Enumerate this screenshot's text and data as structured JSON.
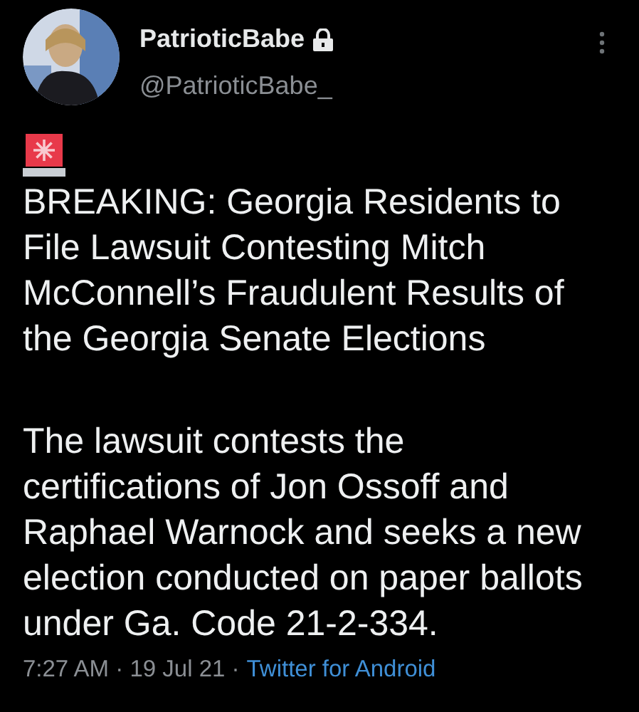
{
  "author": {
    "name": "PatrioticBabe",
    "protected": true,
    "handle": "@PatrioticBabe_"
  },
  "tweet": {
    "headline": "BREAKING: Georgia Residents to File Lawsuit Contesting Mitch McConnell’s Fraudulent Results of the Georgia Senate Elections",
    "body": "The lawsuit contests the certifications of Jon Ossoff and Raphael Warnock and seeks a new election conducted on paper ballots under Ga. Code 21-2-334."
  },
  "meta": {
    "timestamp": "7:27 AM · 19 Jul 21 ·",
    "source": "Twitter for Android"
  }
}
